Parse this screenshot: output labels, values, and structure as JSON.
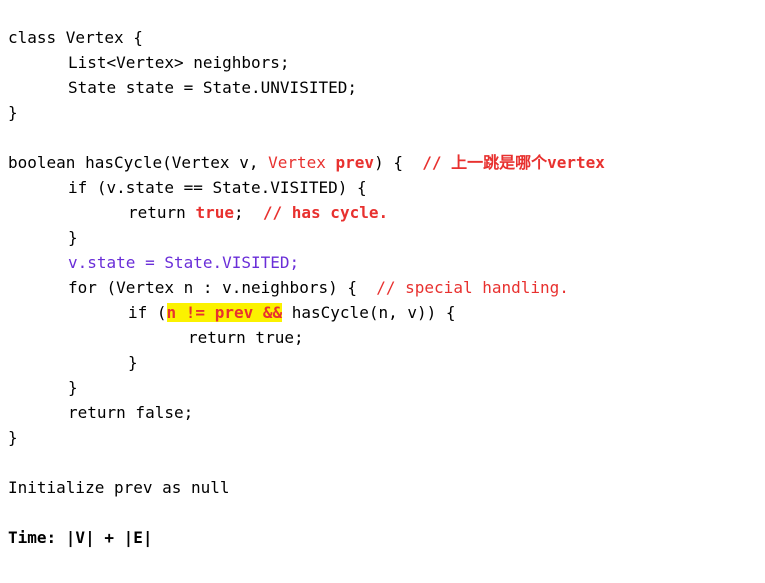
{
  "lines": {
    "l1": "class Vertex {",
    "l2": "List<Vertex> neighbors;",
    "l3": "State state = State.UNVISITED;",
    "l4": "}",
    "l5_a": "boolean hasCycle(Vertex v, ",
    "l5_b": "Vertex ",
    "l5_c": "prev",
    "l5_d": ") {  ",
    "l5_e": "// 上一跳是哪个vertex",
    "l6": "if (v.state == State.VISITED) {",
    "l7_a": "return ",
    "l7_b": "true",
    "l7_c": ";  ",
    "l7_d": "// has cycle.",
    "l8": "}",
    "l9": "v.state = State.VISITED;",
    "l10_a": "for (Vertex n : v.neighbors) {  ",
    "l10_b": "// special handling.",
    "l11_a": "if (",
    "l11_b": "n != prev &&",
    "l11_c": " hasCycle(n, v)) {",
    "l12": "return true;",
    "l13": "}",
    "l14": "}",
    "l15": "return false;",
    "l16": "}",
    "l17": "Initialize prev as null",
    "l18": "Time: |V| + |E|"
  },
  "colors": {
    "red": "#e8312f",
    "purple": "#6a2ed8",
    "highlight": "#fbf200"
  }
}
